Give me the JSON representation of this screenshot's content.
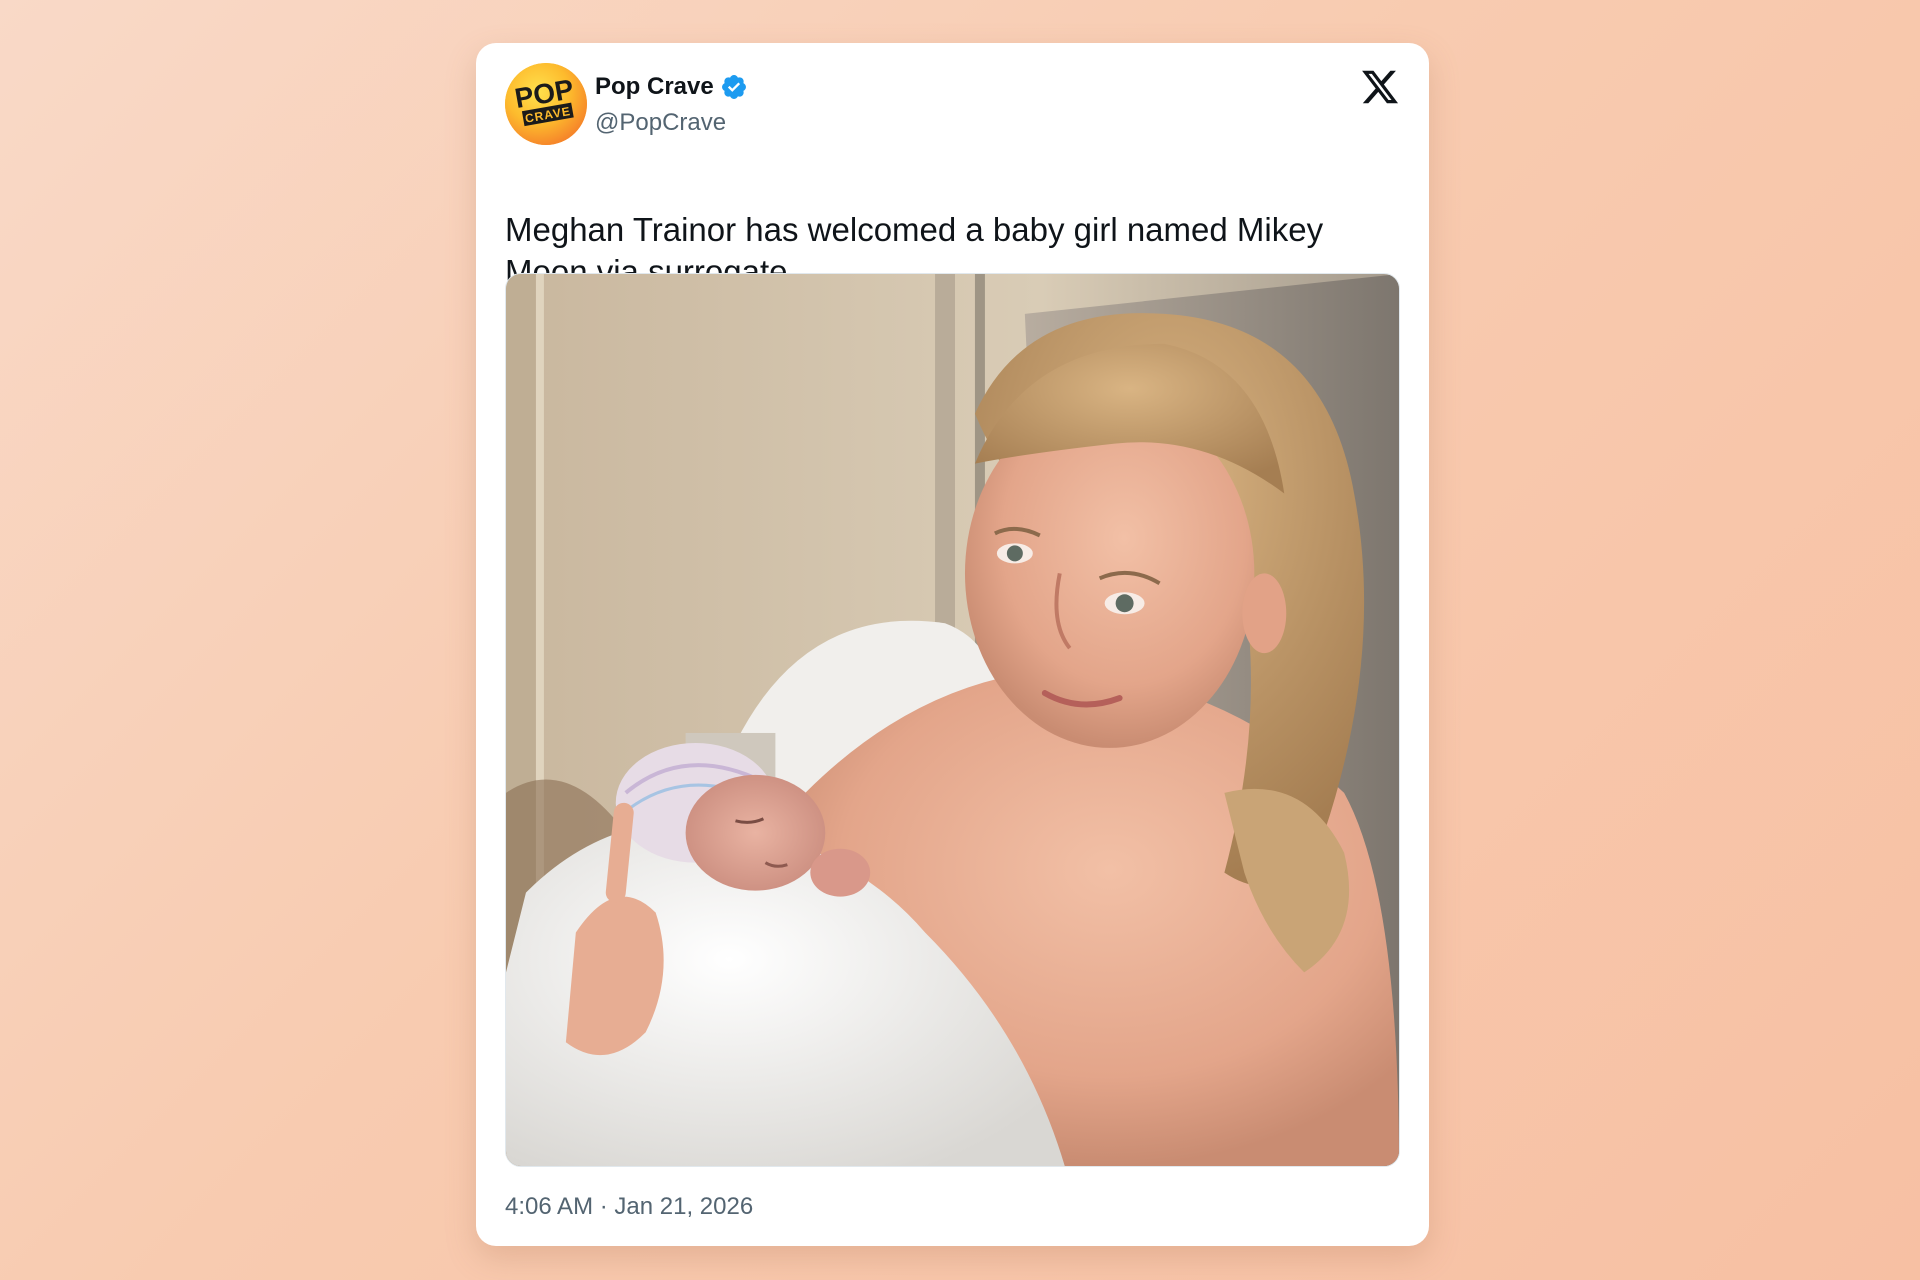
{
  "tweet": {
    "author": {
      "display_name": "Pop Crave",
      "handle": "@PopCrave",
      "verified": true,
      "avatar_text_top": "POP",
      "avatar_text_bottom": "CRAVE"
    },
    "text": "Meghan Trainor has welcomed a baby girl named Mikey Moon via surrogate.",
    "timestamp": "4:06 AM · Jan 21, 2026",
    "platform_icon": "x-logo-icon",
    "media_icon": "photo-mother-holding-newborn"
  },
  "colors": {
    "verified_badge": "#1d9bf0",
    "text_primary": "#0f1419",
    "text_secondary": "#536471",
    "avatar_yellow": "#fdbb2d"
  }
}
